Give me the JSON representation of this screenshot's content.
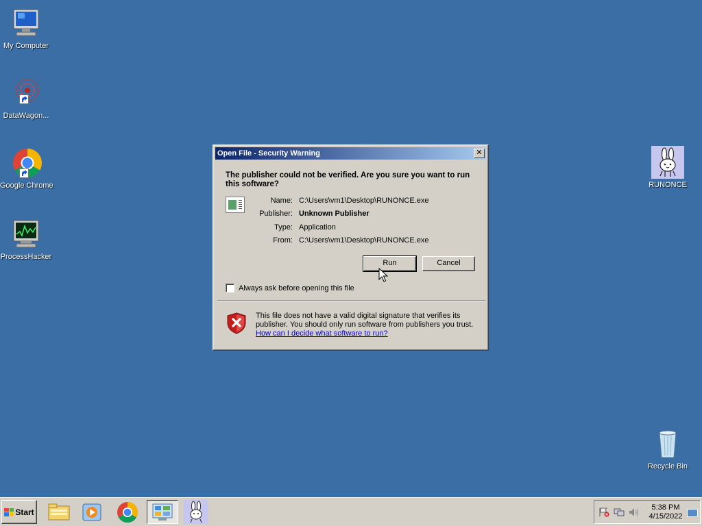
{
  "desktop": {
    "icons": [
      {
        "label": "My Computer",
        "icon": "computer-icon"
      },
      {
        "label": "DataWagon...",
        "icon": "datawagon-icon"
      },
      {
        "label": "Google Chrome",
        "icon": "chrome-icon"
      },
      {
        "label": "ProcessHacker",
        "icon": "processhacker-icon"
      },
      {
        "label": "RUNONCE",
        "icon": "runonce-bunny-icon"
      },
      {
        "label": "Recycle Bin",
        "icon": "recycle-bin-icon"
      }
    ]
  },
  "dialog": {
    "title": "Open File - Security Warning",
    "close_glyph": "✕",
    "headline": "The publisher could not be verified.  Are you sure you want to run this software?",
    "properties": [
      {
        "key": "Name:",
        "value": "C:\\Users\\vm1\\Desktop\\RUNONCE.exe",
        "bold": false
      },
      {
        "key": "Publisher:",
        "value": "Unknown Publisher",
        "bold": true
      },
      {
        "key": "Type:",
        "value": "Application",
        "bold": false
      },
      {
        "key": "From:",
        "value": "C:\\Users\\vm1\\Desktop\\RUNONCE.exe",
        "bold": false
      }
    ],
    "run_label": "Run",
    "cancel_label": "Cancel",
    "always_ask_label": "Always ask before opening this file",
    "always_ask_checked": false,
    "warning_text": "This file does not have a valid digital signature that verifies its publisher.  You should only run software from publishers you trust.",
    "warning_link": "How can I decide what software to run?"
  },
  "taskbar": {
    "start_label": "Start",
    "apps": [
      {
        "icon": "file-explorer-icon",
        "active": false
      },
      {
        "icon": "media-player-icon",
        "active": false
      },
      {
        "icon": "chrome-icon",
        "active": false
      },
      {
        "icon": "control-panel-icon",
        "active": true
      },
      {
        "icon": "runonce-bunny-icon",
        "active": false
      }
    ],
    "tray": {
      "time": "5:38 PM",
      "date": "4/15/2022",
      "icons": [
        "action-center-flag-icon",
        "network-icon",
        "volume-icon"
      ]
    }
  },
  "colors": {
    "desktop_bg": "#3a6ea5",
    "titlebar_start": "#0a246a",
    "titlebar_end": "#a6caf0",
    "dialog_face": "#d4d0c8",
    "link": "#0000cc"
  }
}
